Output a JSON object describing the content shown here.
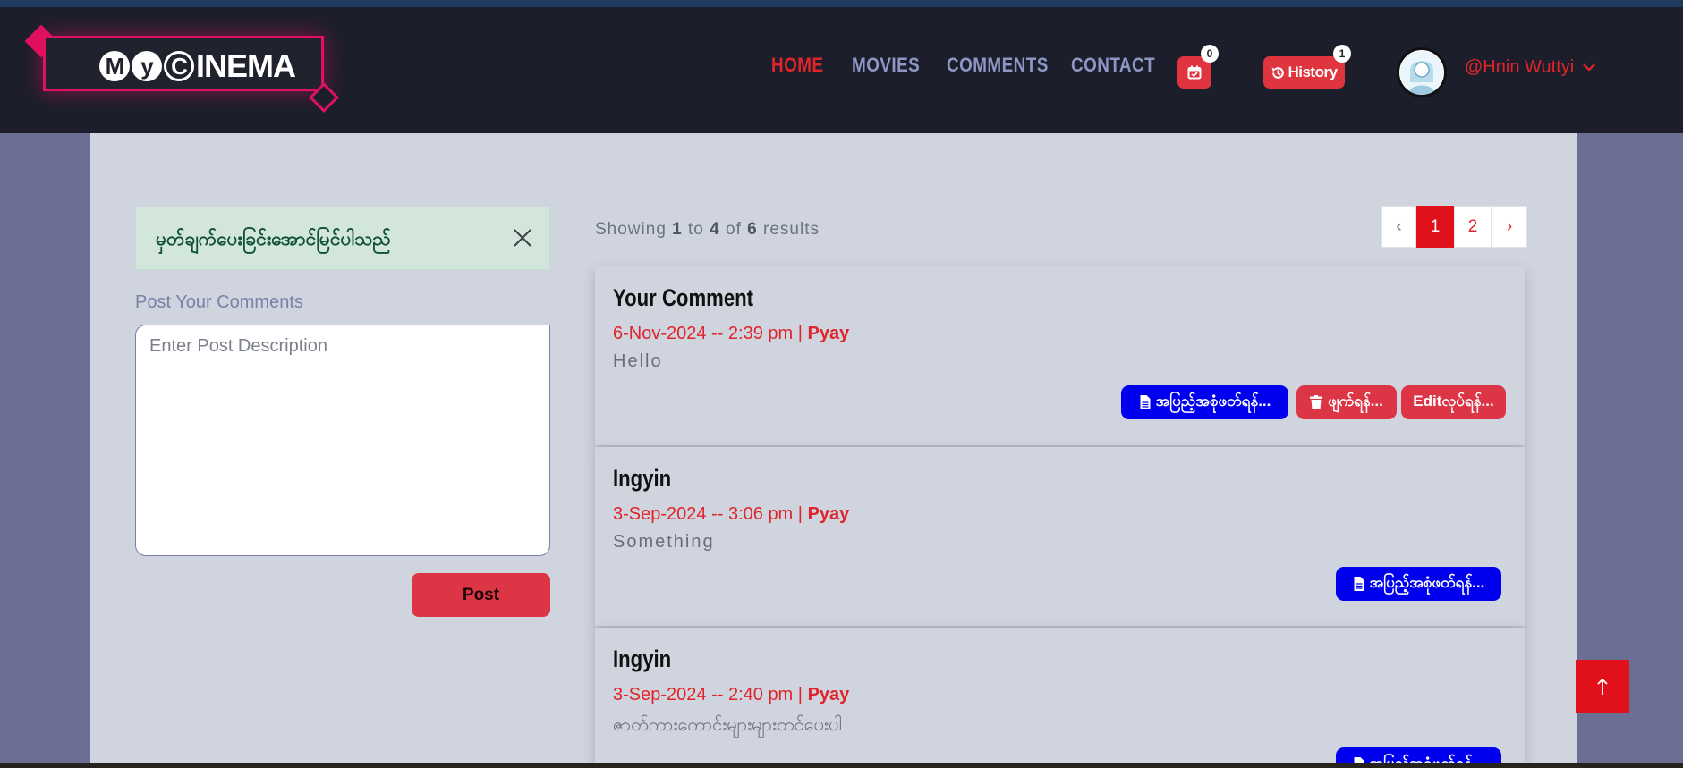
{
  "brand": {
    "m": "M",
    "y": "y",
    "c": "C",
    "rest": "INEMA"
  },
  "nav": {
    "home": "HOME",
    "movies": "MOVIES",
    "comments": "COMMENTS",
    "contact": "CONTACT"
  },
  "header": {
    "calendar_count": "0",
    "history_label": "History",
    "history_count": "1",
    "username": "@Hnin Wuttyi"
  },
  "alert": {
    "message": "မှတ်ချက်ပေးခြင်းအောင်မြင်ပါသည်"
  },
  "post_form": {
    "label": "Post Your Comments",
    "placeholder": "Enter Post Description",
    "submit_label": "Post"
  },
  "results": {
    "prefix": "Showing",
    "from": "1",
    "to_word": "to",
    "to": "4",
    "of_word": "of",
    "total": "6",
    "suffix": "results"
  },
  "pagination": {
    "prev": "‹",
    "pages": [
      "1",
      "2"
    ],
    "current": "1",
    "next": "›"
  },
  "comments": [
    {
      "title": "Your Comment",
      "date": "6-Nov-2024 -- 2:39 pm",
      "separator": "|",
      "location": "Pyay",
      "body": "Hello",
      "report_label": "အပြည့်အစုံဖတ်ရန်...",
      "delete_label": "ဖျက်ရန်...",
      "edit_label": "Editလုပ်ရန်..."
    },
    {
      "title": "Ingyin",
      "date": "3-Sep-2024 -- 3:06 pm",
      "separator": "|",
      "location": "Pyay",
      "body": "Something",
      "report_label": "အပြည့်အစုံဖတ်ရန်..."
    },
    {
      "title": "Ingyin",
      "date": "3-Sep-2024 -- 2:40 pm",
      "separator": "|",
      "location": "Pyay",
      "body": "ဇာတ်ကားကောင်းများများတင်ပေးပါ",
      "report_label": "အပြည့်အစုံဖတ်ရန်..."
    }
  ],
  "colors": {
    "accent": "#e0252a",
    "navbar": "#1c1e2b",
    "panel": "#d0d4de",
    "brand_pink": "#e0115f",
    "blue_button": "#0000ee"
  },
  "icons": [
    "calendar-check-icon",
    "history-icon",
    "chevron-down-icon",
    "close-icon",
    "file-icon",
    "trash-icon",
    "arrow-up-icon"
  ]
}
